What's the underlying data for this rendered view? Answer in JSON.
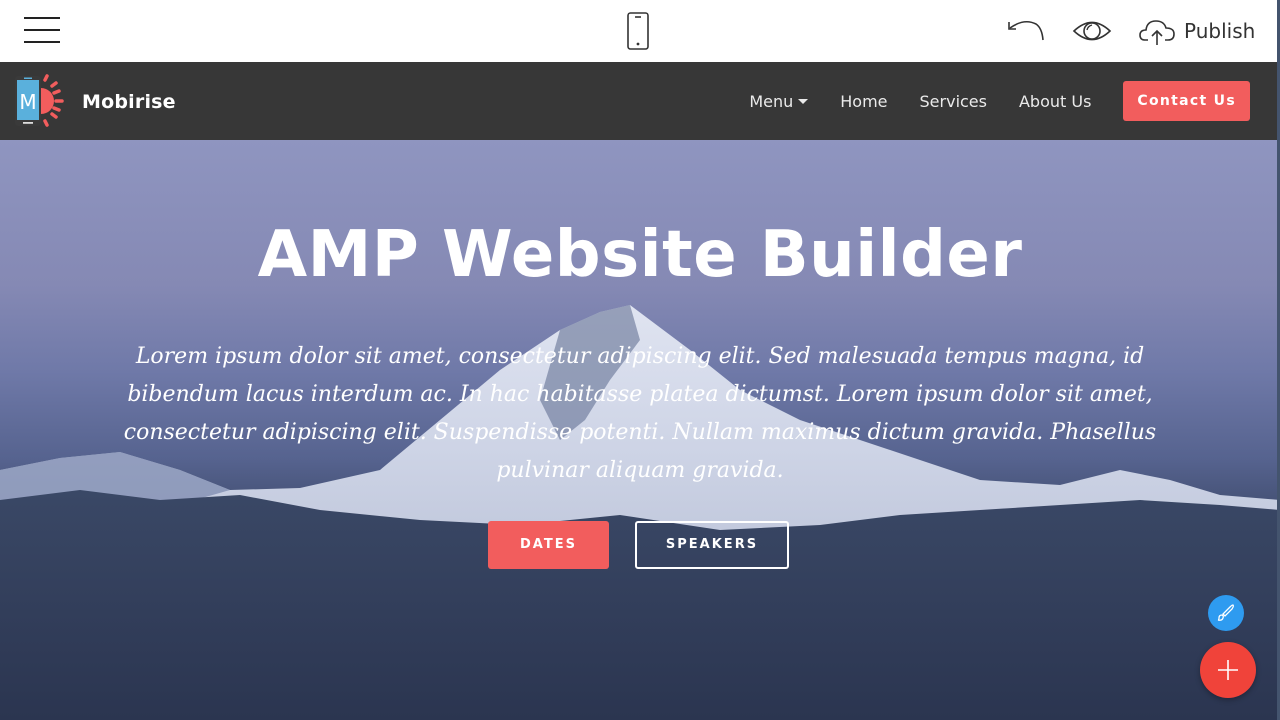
{
  "editor": {
    "menu_icon": "hamburger-icon",
    "device_icon": "mobile-phone-icon",
    "undo_icon": "undo-icon",
    "preview_icon": "eye-icon",
    "publish_icon": "cloud-upload-icon",
    "publish_label": "Publish"
  },
  "site_nav": {
    "brand_name": "Mobirise",
    "brand_logo_letter": "M",
    "links": [
      {
        "label": "Menu",
        "has_dropdown": true
      },
      {
        "label": "Home"
      },
      {
        "label": "Services"
      },
      {
        "label": "About Us"
      }
    ],
    "cta_label": "Contact Us"
  },
  "hero": {
    "title": "AMP Website Builder",
    "text": "Lorem ipsum dolor sit amet, consectetur adipiscing elit. Sed malesuada tempus magna, id bibendum lacus interdum ac. In hac habitasse platea dictumst. Lorem ipsum dolor sit amet, consectetur adipiscing elit. Suspendisse potenti. Nullam maximus dictum gravida. Phasellus pulvinar aliquam gravida.",
    "primary_button": "DATES",
    "secondary_button": "SPEAKERS"
  },
  "floating": {
    "style_icon": "paintbrush-icon",
    "add_icon": "plus-icon"
  },
  "colors": {
    "accent": "#f25d5d",
    "navbar": "#373737",
    "fab_blue": "#2e9bf0",
    "fab_red": "#f0433a"
  }
}
